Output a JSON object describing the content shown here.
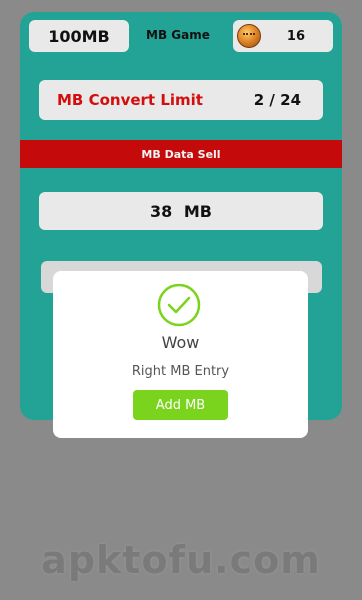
{
  "header": {
    "mb_balance": "100MB",
    "game_label": "MB Game",
    "coin_icon": "coin-icon",
    "coin_count": "16"
  },
  "convert_limit": {
    "label": "MB Convert Limit",
    "count": "2 / 24"
  },
  "banner": {
    "label": "MB Data Sell"
  },
  "entry": {
    "value": "38 MB"
  },
  "dialog": {
    "icon": "checkmark-circle-icon",
    "title": "Wow",
    "message": "Right MB Entry",
    "button_label": "Add MB"
  },
  "colors": {
    "card": "#23a396",
    "banner": "#c40a0a",
    "limit_text": "#d40d0d",
    "button": "#7ad31d",
    "check": "#7ad31d"
  },
  "watermark": "apktofu.com"
}
